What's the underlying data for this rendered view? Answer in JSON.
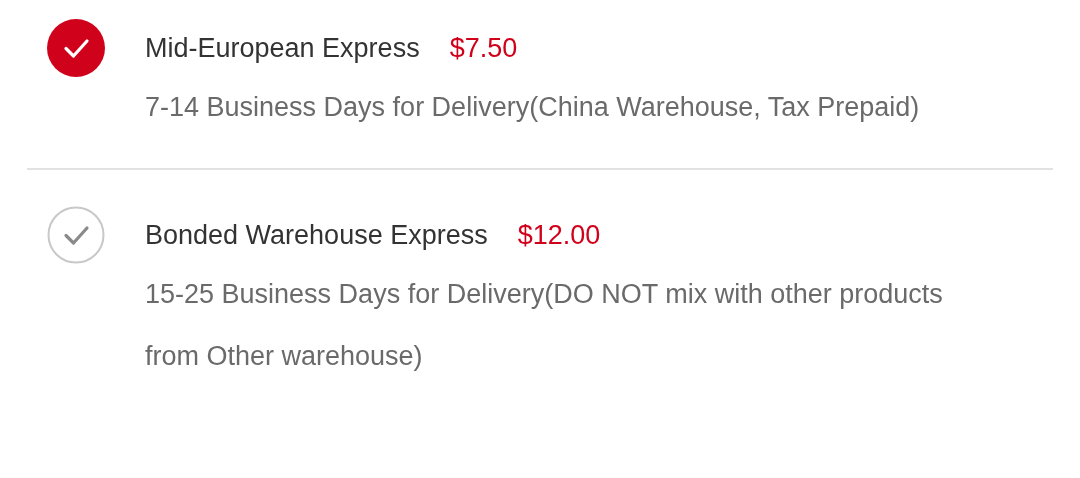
{
  "shipping_options": [
    {
      "name": "Mid-European Express",
      "price": "$7.50",
      "description": "7-14 Business Days for Delivery(China Warehouse, Tax Prepaid)",
      "selected": true
    },
    {
      "name": "Bonded Warehouse Express",
      "price": "$12.00",
      "description": "15-25 Business Days for Delivery(DO NOT mix with other products from Other warehouse)",
      "selected": false
    }
  ]
}
